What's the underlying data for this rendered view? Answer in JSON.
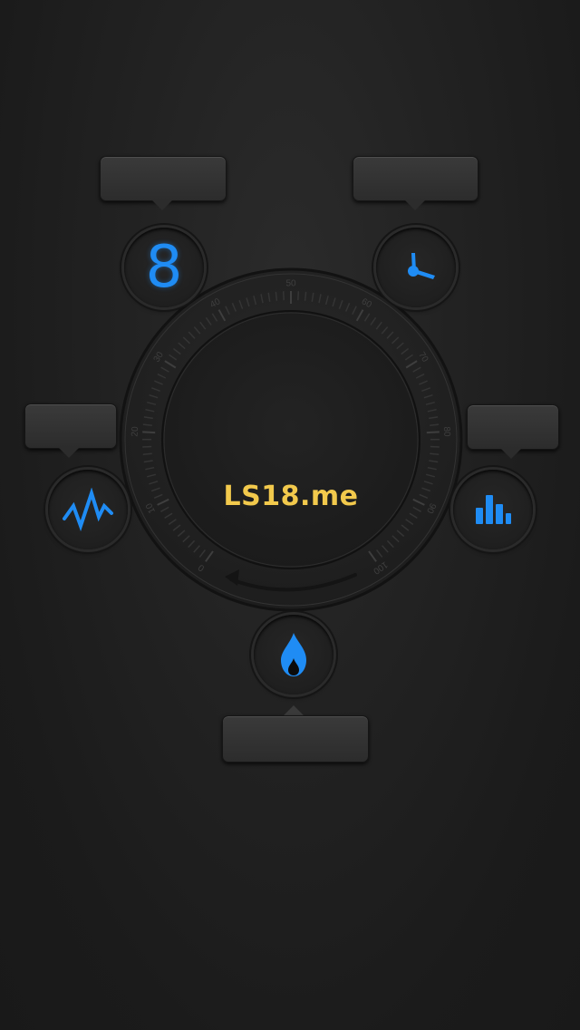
{
  "center": {
    "label": "LS18.me",
    "label_color": "#f2c94c"
  },
  "dial": {
    "scale_labels": [
      "0",
      "10",
      "20",
      "30",
      "40",
      "50",
      "60",
      "70",
      "80",
      "90",
      "100"
    ],
    "accent_color": "#1f8cf4"
  },
  "buttons": {
    "count": {
      "digit": "8",
      "icon": "digit-eight"
    },
    "timer": {
      "icon": "clock-hands-icon"
    },
    "activity": {
      "icon": "pulse-wave-icon"
    },
    "stats": {
      "icon": "bar-chart-icon"
    },
    "calories": {
      "icon": "flame-icon"
    }
  },
  "tooltips": {
    "count": "",
    "timer": "",
    "activity": "",
    "stats": "",
    "calories": ""
  }
}
